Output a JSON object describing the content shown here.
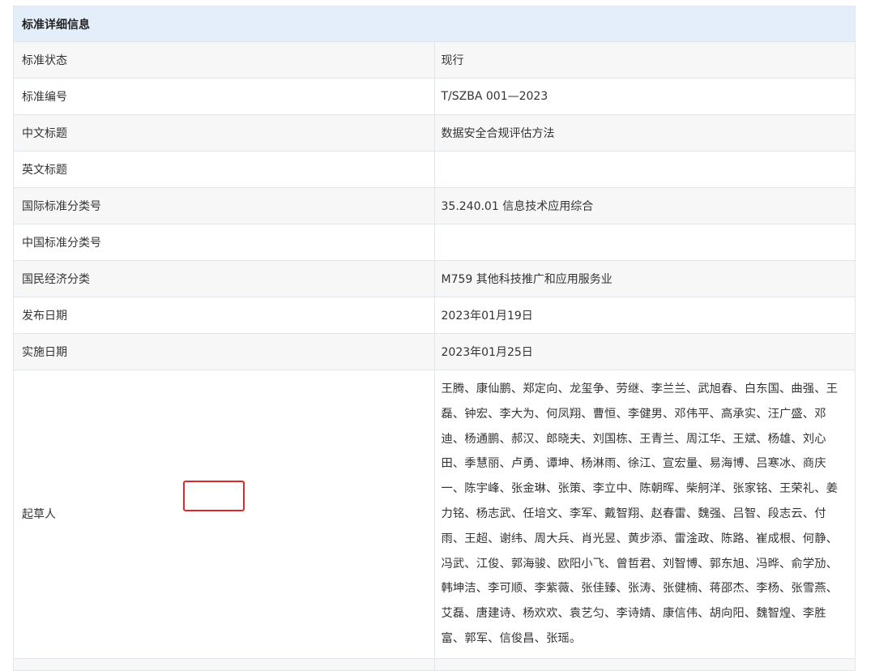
{
  "header": {
    "title": "标准详细信息"
  },
  "rows": [
    {
      "label": "标准状态",
      "value": "现行"
    },
    {
      "label": "标准编号",
      "value": "T/SZBA 001—2023"
    },
    {
      "label": "中文标题",
      "value": "数据安全合规评估方法"
    },
    {
      "label": "英文标题",
      "value": ""
    },
    {
      "label": "国际标准分类号",
      "value": "35.240.01 信息技术应用综合"
    },
    {
      "label": "中国标准分类号",
      "value": ""
    },
    {
      "label": "国民经济分类",
      "value": "M759 其他科技推广和应用服务业"
    },
    {
      "label": "发布日期",
      "value": "2023年01月19日"
    },
    {
      "label": "实施日期",
      "value": "2023年01月25日"
    }
  ],
  "drafters": {
    "label": "起草人",
    "value": "王腾、康仙鹏、郑定向、龙玺争、劳继、李兰兰、武旭春、白东国、曲强、王磊、钟宏、李大为、何凤翔、曹恒、李健男、邓伟平、高承实、汪广盛、邓迪、杨通鹏、郝汉、郎晓夫、刘国栋、王青兰、周江华、王斌、杨雄、刘心田、季慧丽、卢勇、谭坤、杨淋雨、徐江、宣宏量、易海博、吕寒冰、商庆一、陈宇峰、张金琳、张策、李立中、陈朝晖、柴舸洋、张家铭、王荣礼、姜力铭、杨志武、任培文、李军、戴智翔、赵春雷、魏强、吕智、段志云、付雨、王超、谢纬、周大兵、肖光昱、黄步添、雷淦政、陈路、崔成根、何静、冯武、江俊、郭海骏、欧阳小飞、曾哲君、刘智博、郭东旭、冯晔、俞学劢、韩坤洁、李可顺、李紫薇、张佳臻、张涛、张健楠、蒋邵杰、李杨、张雪燕、艾磊、唐建诗、杨欢欢、袁艺匀、李诗婧、康信伟、胡向阳、魏智煌、李胜富、郭军、信俊昌、张瑶。"
  },
  "colors": {
    "header_bg": "#e3eefa",
    "border": "#e2e6ea",
    "highlight": "#e3262d"
  }
}
